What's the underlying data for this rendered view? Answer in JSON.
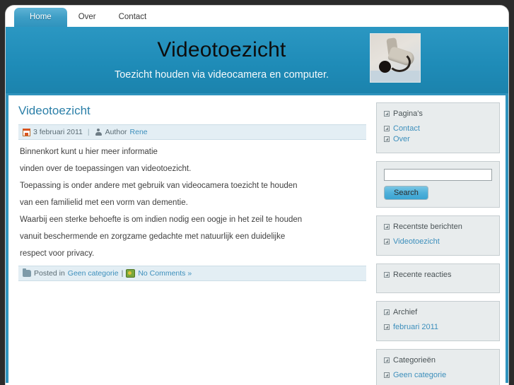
{
  "nav": {
    "items": [
      {
        "label": "Home",
        "active": true
      },
      {
        "label": "Over",
        "active": false
      },
      {
        "label": "Contact",
        "active": false
      }
    ]
  },
  "header": {
    "title": "Videotoezicht",
    "tagline": "Toezicht houden via videocamera en computer.",
    "photo_alt": "security-camera-photo"
  },
  "post": {
    "title": "Videotoezicht",
    "date": "3 februari 2011",
    "author_prefix": "Author",
    "author": "Rene",
    "separator": "|",
    "paragraphs": [
      "Binnenkort kunt u hier meer informatie",
      "vinden over de toepassingen van videotoezicht.",
      "Toepassing is onder andere met gebruik van videocamera toezicht te houden",
      "van een familielid met een vorm van dementie.",
      "Waarbij een sterke behoefte is om indien nodig een oogje in het zeil te houden",
      "vanuit beschermende en zorgzame gedachte met natuurlijk een duidelijke",
      "respect voor privacy."
    ],
    "footer": {
      "posted_in_label": "Posted in",
      "category": "Geen categorie",
      "separator": "|",
      "comments": "No Comments »"
    }
  },
  "sidebar": {
    "widgets": [
      {
        "title": "Pagina's",
        "links": [
          "Contact",
          "Over"
        ]
      },
      {
        "title": "Recentste berichten",
        "links": [
          "Videotoezicht"
        ]
      },
      {
        "title": "Recente reacties",
        "links": []
      },
      {
        "title": "Archief",
        "links": [
          "februari 2011"
        ]
      },
      {
        "title": "Categorieën",
        "links": [
          "Geen categorie"
        ]
      }
    ],
    "search": {
      "value": "",
      "placeholder": "",
      "button_label": "Search"
    }
  },
  "colors": {
    "accent": "#1f8cb8",
    "link": "#3d8fbc",
    "meta_bg": "#e3eef4",
    "widget_bg": "#e8eced"
  }
}
